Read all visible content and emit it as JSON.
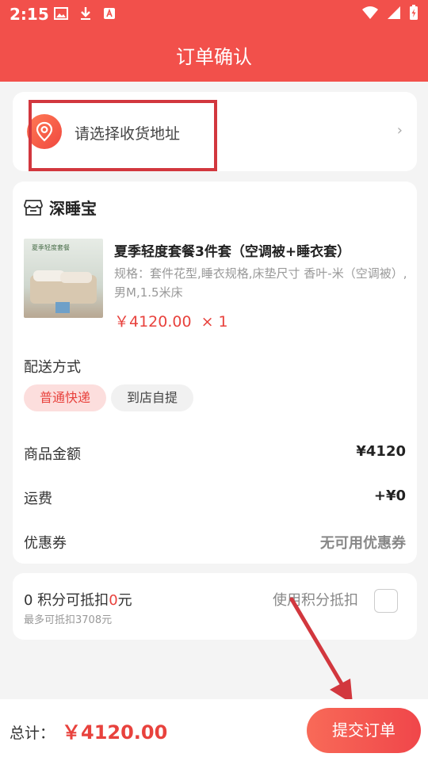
{
  "status_bar": {
    "time": "2:15"
  },
  "header": {
    "title": "订单确认"
  },
  "address": {
    "placeholder": "请选择收货地址",
    "chevron": "›"
  },
  "shop": {
    "name": "深睡宝"
  },
  "product": {
    "image_label": "夏季轻度套餐",
    "name": "夏季轻度套餐3件套（空调被+睡衣套）",
    "spec": "规格：套件花型,睡衣规格,床垫尺寸 香叶-米（空调被）,男M,1.5米床",
    "price": "￥4120.00",
    "quantity": "× 1"
  },
  "delivery": {
    "label": "配送方式",
    "options": [
      "普通快递",
      "到店自提"
    ],
    "selected": "普通快递"
  },
  "summary": {
    "goods_label": "商品金额",
    "goods_value": "¥4120",
    "shipping_label": "运费",
    "shipping_value": "+¥0",
    "coupon_label": "优惠券",
    "coupon_value": "无可用优惠券"
  },
  "points": {
    "count": "0",
    "text_a": " 积分可抵扣",
    "deduct_value": "0",
    "text_b": "元",
    "max_note": "最多可抵扣3708元",
    "use_label": "使用积分抵扣",
    "use_checked": false
  },
  "footer": {
    "total_label": "总计：",
    "total_value": "￥4120.00",
    "submit_label": "提交订单"
  },
  "colors": {
    "brand": "#f2504b",
    "price_red": "#e8423d",
    "annotation": "#d2373e"
  },
  "icons": {
    "location": "location-pin-icon",
    "shop": "store-icon",
    "chevron": "chevron-right-icon",
    "image": "image-icon",
    "download": "download-icon",
    "font": "font-icon",
    "wifi": "wifi-icon",
    "signal": "signal-icon",
    "battery": "battery-icon"
  }
}
